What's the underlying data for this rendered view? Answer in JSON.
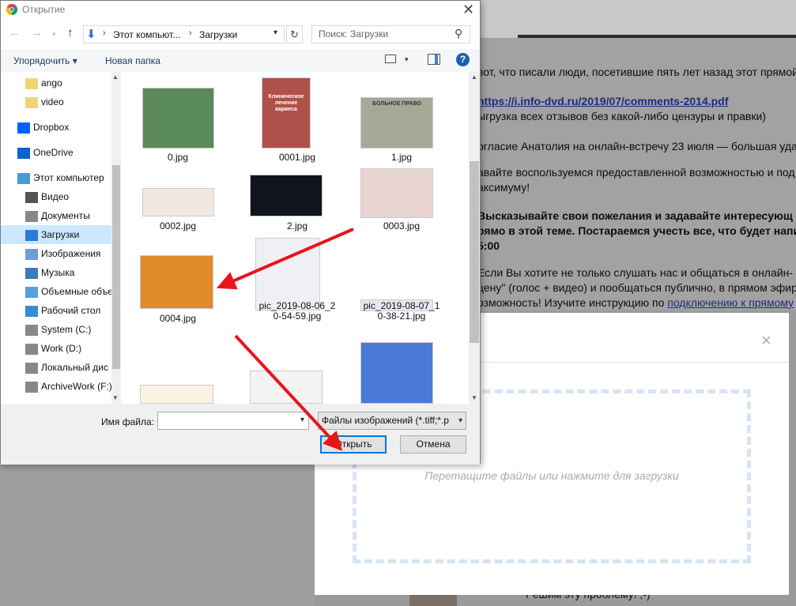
{
  "dialog": {
    "title": "Открытие"
  },
  "address": {
    "crumbs": [
      "Этот компьют...",
      "Загрузки"
    ],
    "sep": "›"
  },
  "search": {
    "placeholder": "Поиск: Загрузки"
  },
  "toolbar": {
    "organize": "Упорядочить ▾",
    "new_folder": "Новая папка",
    "help": "?"
  },
  "nav": [
    {
      "label": "ango",
      "icon": "folder-icon"
    },
    {
      "label": "video",
      "icon": "folder-icon"
    },
    {
      "label": "Dropbox",
      "icon": "dropbox-icon"
    },
    {
      "label": "OneDrive",
      "icon": "onedrive-icon"
    },
    {
      "label": "Этот компьютер",
      "icon": "computer-icon"
    },
    {
      "label": "Видео",
      "icon": "video-icon"
    },
    {
      "label": "Документы",
      "icon": "documents-icon"
    },
    {
      "label": "Загрузки",
      "icon": "downloads-icon",
      "selected": true
    },
    {
      "label": "Изображения",
      "icon": "pictures-icon"
    },
    {
      "label": "Музыка",
      "icon": "music-icon"
    },
    {
      "label": "Объемные объе",
      "icon": "3d-objects-icon"
    },
    {
      "label": "Рабочий стол",
      "icon": "desktop-icon"
    },
    {
      "label": "System (C:)",
      "icon": "drive-icon"
    },
    {
      "label": "Work (D:)",
      "icon": "drive-icon"
    },
    {
      "label": "Локальный дис",
      "icon": "drive-icon"
    },
    {
      "label": "ArchiveWork (F:)",
      "icon": "drive-icon"
    }
  ],
  "files": [
    {
      "name": "0.jpg"
    },
    {
      "name": "0001.jpg",
      "thumb_text": "Клиническое лечение кариеса"
    },
    {
      "name": "1.jpg",
      "thumb_text": "БОЛЬНОЕ ПРАВО"
    },
    {
      "name": "0002.jpg"
    },
    {
      "name": "2.jpg"
    },
    {
      "name": "0003.jpg"
    },
    {
      "name": "0004.jpg"
    },
    {
      "name": "pic_2019-08-06_2\n0-54-59.jpg"
    },
    {
      "name": "pic_2019-08-07_1\n0-38-21.jpg"
    },
    {
      "name": ""
    },
    {
      "name": ""
    },
    {
      "name": ""
    }
  ],
  "footer": {
    "filename_label": "Имя файла:",
    "filename_value": "",
    "filetype": "Файлы изображений (*.tiff;*.p",
    "open": "Открыть",
    "cancel": "Отмена"
  },
  "background": {
    "forum_lines": [
      "вот, что писали люди, посетившие пять лет назад этот прямой",
      "https://i.info-dvd.ru/2019/07/comments-2014.pdf",
      "ыгрузка всех отзывов без какой-либо цензуры и правки)",
      "огласие Анатолия на онлайн-встречу 23 июля — большая уда",
      "авайте воспользуемся предоставленной возможностью и под",
      "аксимуму!",
      " Высказывайте свои пожелания и задавайте интересующ",
      "рямо в этой теме. Постараемся учесть все, что будет напи",
      "5:00",
      " Если Вы хотите не только слушать нас и общаться в онлайн-",
      "цену\" (голос + видео) и пообщаться публично, в прямом эфир",
      "озможность! Изучите инструкцию по "
    ],
    "forum_link2": "подключению к прямому",
    "upload_hint": "Перетащите файлы или нажмите для загрузки",
    "bottom_text": "Решим эту проблему! ;-)",
    "close": "×"
  }
}
